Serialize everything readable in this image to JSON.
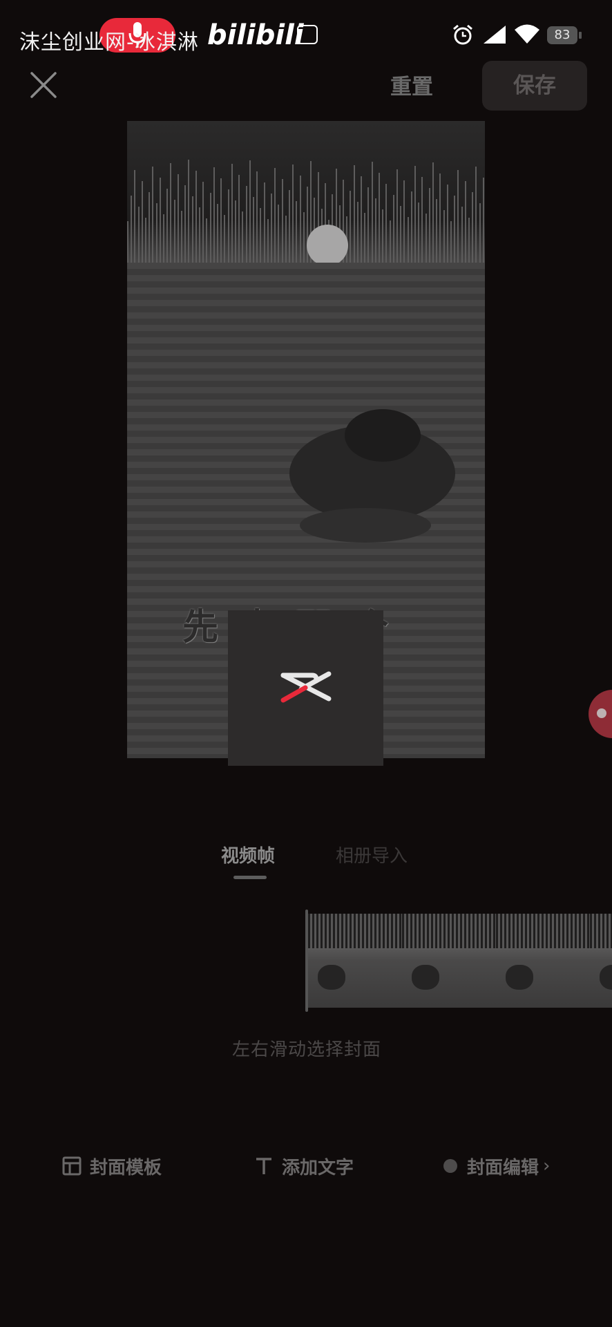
{
  "status_bar": {
    "watermark": "沫尘创业网-冰淇淋",
    "bili_text": "bilibili",
    "battery": "83"
  },
  "top_bar": {
    "reset_label": "重置",
    "save_label": "保存"
  },
  "preview": {
    "caption": "先 去 那 个"
  },
  "tabs": [
    {
      "label": "视频帧",
      "active": true
    },
    {
      "label": "相册导入",
      "active": false
    }
  ],
  "filmstrip": {
    "hint": "左右滑动选择封面"
  },
  "toolbar": {
    "template_label": "封面模板",
    "text_label": "添加文字",
    "edit_label": "封面编辑",
    "edit_chevron": "›"
  },
  "colors": {
    "accent_red": "#e8293a",
    "background": "#0f0b0b"
  },
  "icons": [
    "close-icon",
    "mic-icon",
    "tv-icon",
    "alarm-icon",
    "signal-icon",
    "wifi-icon",
    "capcut-icon",
    "template-icon",
    "text-icon",
    "edit-dot-icon"
  ]
}
